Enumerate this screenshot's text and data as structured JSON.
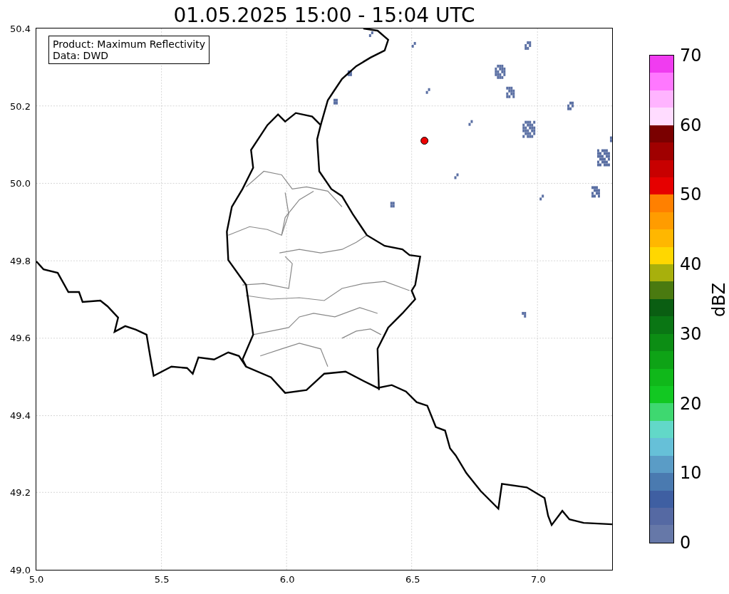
{
  "title": "01.05.2025 15:00 - 15:04 UTC",
  "legend": {
    "lines": [
      "Product: Maximum Reflectivity",
      "Data: DWD"
    ]
  },
  "map": {
    "x_ticks": [
      "5.0",
      "5.5",
      "6.0",
      "6.5",
      "7.0"
    ],
    "y_ticks": [
      "50.4",
      "50.2",
      "50.0",
      "49.8",
      "49.6",
      "49.4",
      "49.2",
      "49.0"
    ]
  },
  "colorbar": {
    "label": "dBZ",
    "ticks": [
      "70",
      "60",
      "50",
      "40",
      "30",
      "20",
      "10",
      "0"
    ],
    "segments": [
      {
        "color": "#6678a8"
      },
      {
        "color": "#5569a3"
      },
      {
        "color": "#3f5fa2"
      },
      {
        "color": "#4a7ab0"
      },
      {
        "color": "#5a9cc6"
      },
      {
        "color": "#66c0d8"
      },
      {
        "color": "#62d8c8"
      },
      {
        "color": "#3ed870"
      },
      {
        "color": "#12c822"
      },
      {
        "color": "#10b81a"
      },
      {
        "color": "#0ea316"
      },
      {
        "color": "#0c8d14"
      },
      {
        "color": "#0a7614"
      },
      {
        "color": "#0a5e12"
      },
      {
        "color": "#4a7a10"
      },
      {
        "color": "#a8b00c"
      },
      {
        "color": "#ffd700"
      },
      {
        "color": "#ffb700"
      },
      {
        "color": "#ff9c00"
      },
      {
        "color": "#ff8000"
      },
      {
        "color": "#e60000"
      },
      {
        "color": "#c80000"
      },
      {
        "color": "#a00000"
      },
      {
        "color": "#7a0000"
      },
      {
        "color": "#ffdcff"
      },
      {
        "color": "#ffb4ff"
      },
      {
        "color": "#ff78ff"
      },
      {
        "color": "#f03cf0"
      }
    ]
  }
}
